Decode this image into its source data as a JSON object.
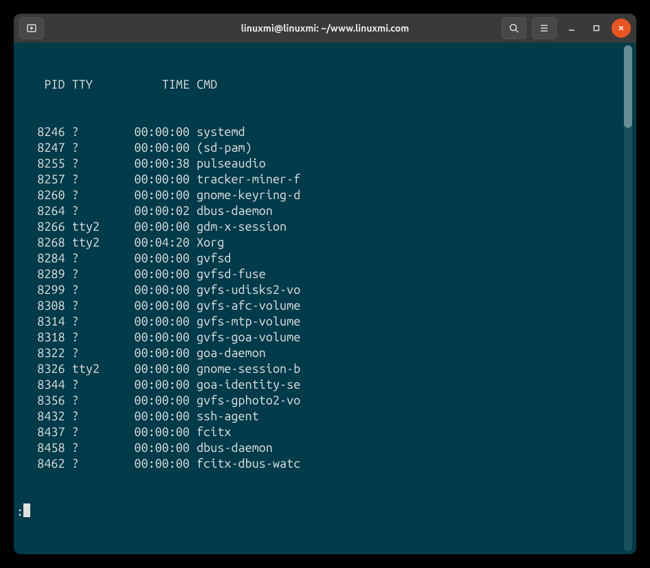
{
  "window": {
    "title": "linuxmi@linuxmi: ~/www.linuxmi.com"
  },
  "header": {
    "pid": "PID",
    "tty": "TTY",
    "time": "TIME",
    "cmd": "CMD"
  },
  "processes": [
    {
      "pid": "8246",
      "tty": "?",
      "time": "00:00:00",
      "cmd": "systemd"
    },
    {
      "pid": "8247",
      "tty": "?",
      "time": "00:00:00",
      "cmd": "(sd-pam)"
    },
    {
      "pid": "8255",
      "tty": "?",
      "time": "00:00:38",
      "cmd": "pulseaudio"
    },
    {
      "pid": "8257",
      "tty": "?",
      "time": "00:00:00",
      "cmd": "tracker-miner-f"
    },
    {
      "pid": "8260",
      "tty": "?",
      "time": "00:00:00",
      "cmd": "gnome-keyring-d"
    },
    {
      "pid": "8264",
      "tty": "?",
      "time": "00:00:02",
      "cmd": "dbus-daemon"
    },
    {
      "pid": "8266",
      "tty": "tty2",
      "time": "00:00:00",
      "cmd": "gdm-x-session"
    },
    {
      "pid": "8268",
      "tty": "tty2",
      "time": "00:04:20",
      "cmd": "Xorg"
    },
    {
      "pid": "8284",
      "tty": "?",
      "time": "00:00:00",
      "cmd": "gvfsd"
    },
    {
      "pid": "8289",
      "tty": "?",
      "time": "00:00:00",
      "cmd": "gvfsd-fuse"
    },
    {
      "pid": "8299",
      "tty": "?",
      "time": "00:00:00",
      "cmd": "gvfs-udisks2-vo"
    },
    {
      "pid": "8308",
      "tty": "?",
      "time": "00:00:00",
      "cmd": "gvfs-afc-volume"
    },
    {
      "pid": "8314",
      "tty": "?",
      "time": "00:00:00",
      "cmd": "gvfs-mtp-volume"
    },
    {
      "pid": "8318",
      "tty": "?",
      "time": "00:00:00",
      "cmd": "gvfs-goa-volume"
    },
    {
      "pid": "8322",
      "tty": "?",
      "time": "00:00:00",
      "cmd": "goa-daemon"
    },
    {
      "pid": "8326",
      "tty": "tty2",
      "time": "00:00:00",
      "cmd": "gnome-session-b"
    },
    {
      "pid": "8344",
      "tty": "?",
      "time": "00:00:00",
      "cmd": "goa-identity-se"
    },
    {
      "pid": "8356",
      "tty": "?",
      "time": "00:00:00",
      "cmd": "gvfs-gphoto2-vo"
    },
    {
      "pid": "8432",
      "tty": "?",
      "time": "00:00:00",
      "cmd": "ssh-agent"
    },
    {
      "pid": "8437",
      "tty": "?",
      "time": "00:00:00",
      "cmd": "fcitx"
    },
    {
      "pid": "8458",
      "tty": "?",
      "time": "00:00:00",
      "cmd": "dbus-daemon"
    },
    {
      "pid": "8462",
      "tty": "?",
      "time": "00:00:00",
      "cmd": "fcitx-dbus-watc"
    }
  ],
  "prompt": ":"
}
